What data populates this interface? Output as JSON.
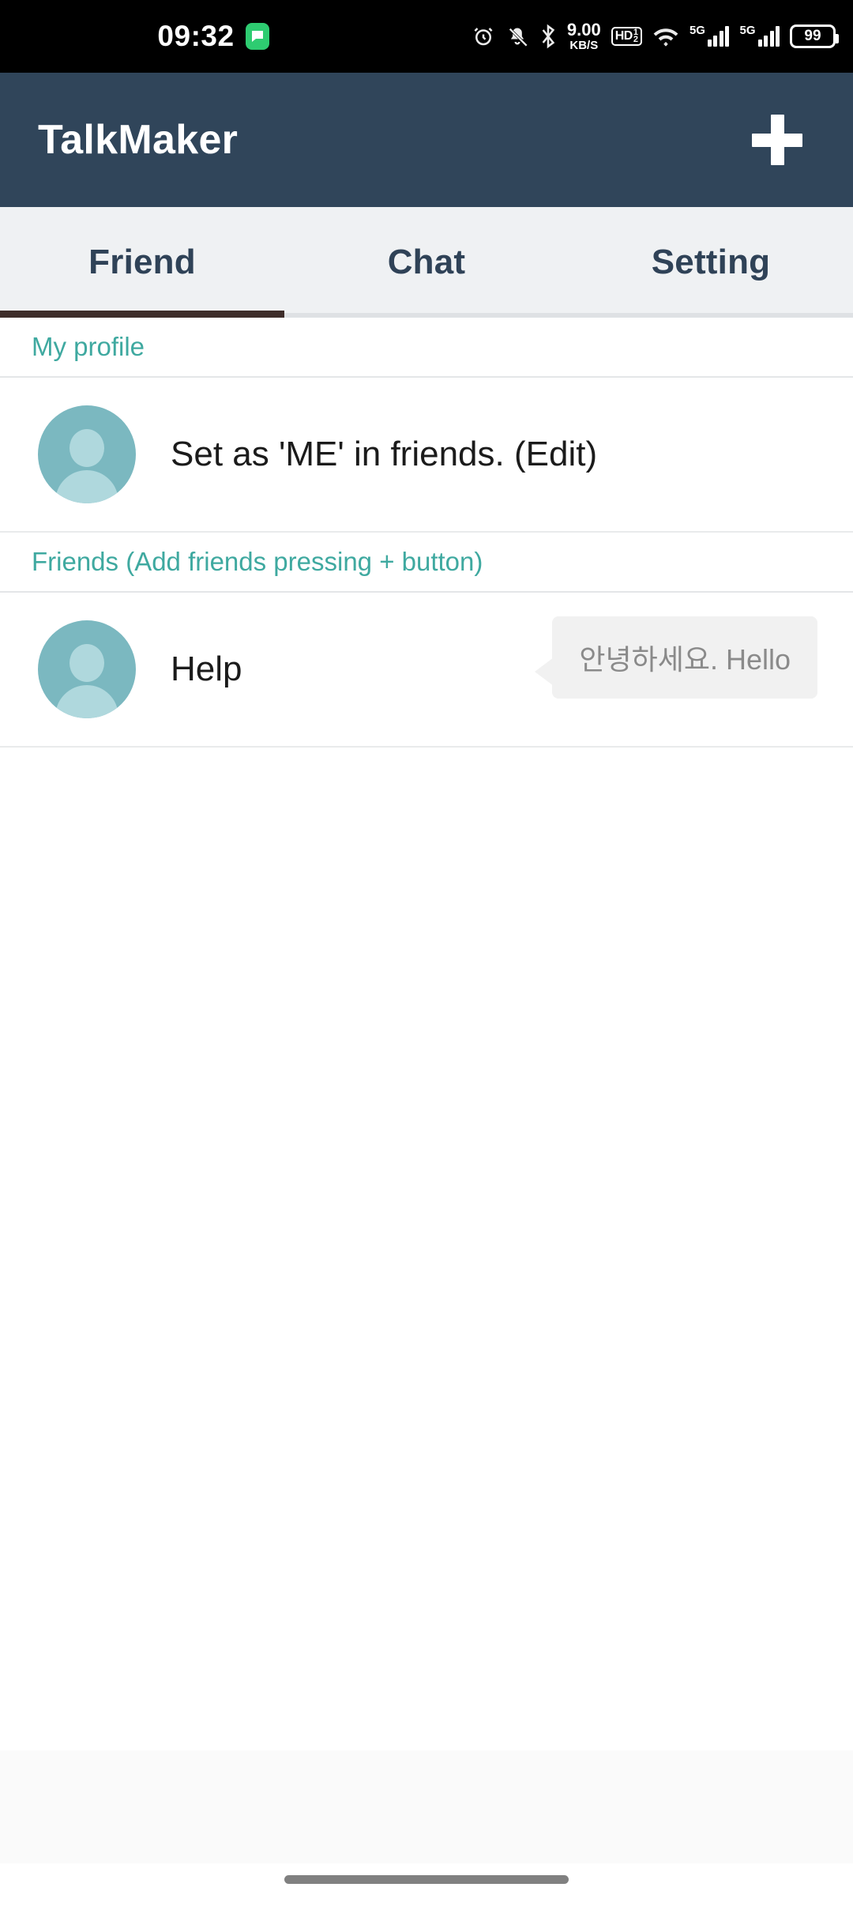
{
  "status_bar": {
    "time": "09:32",
    "app_badge_icon": "chat-bubble-icon",
    "alarm_icon": "alarm-clock-icon",
    "mute_icon": "bell-muted-icon",
    "bluetooth_icon": "bluetooth-icon",
    "data_rate_value": "9.00",
    "data_rate_unit": "KB/S",
    "hd_label": "HD",
    "hd_sub": "1",
    "hd_sub2": "2",
    "wifi_icon": "wifi-icon",
    "network_1_label": "5G",
    "network_2_label": "5G",
    "battery_level": "99"
  },
  "app_bar": {
    "title": "TalkMaker",
    "add_button_icon": "plus-icon",
    "background_color": "#30455A"
  },
  "tabs": {
    "items": [
      {
        "label": "Friend",
        "active": true
      },
      {
        "label": "Chat",
        "active": false
      },
      {
        "label": "Setting",
        "active": false
      }
    ],
    "indicator_color": "#3E2D2A",
    "text_color": "#2F4257",
    "background_color": "#EFF1F3"
  },
  "sections": [
    {
      "header": "My profile",
      "rows": [
        {
          "avatar_icon": "person-avatar-icon",
          "name": "Set as 'ME' in friends. (Edit)",
          "bubble": null
        }
      ]
    },
    {
      "header": "Friends (Add friends pressing + button)",
      "rows": [
        {
          "avatar_icon": "person-avatar-icon",
          "name": "Help",
          "bubble": "안녕하세요. Hello"
        }
      ]
    }
  ],
  "colors": {
    "accent_teal": "#3FA9A0",
    "avatar_teal": "#7BB8C0",
    "bubble_bg": "#F1F1F1",
    "bubble_text": "#8A8A8A"
  },
  "system_nav": {
    "home_indicator": "home-gesture-pill"
  }
}
